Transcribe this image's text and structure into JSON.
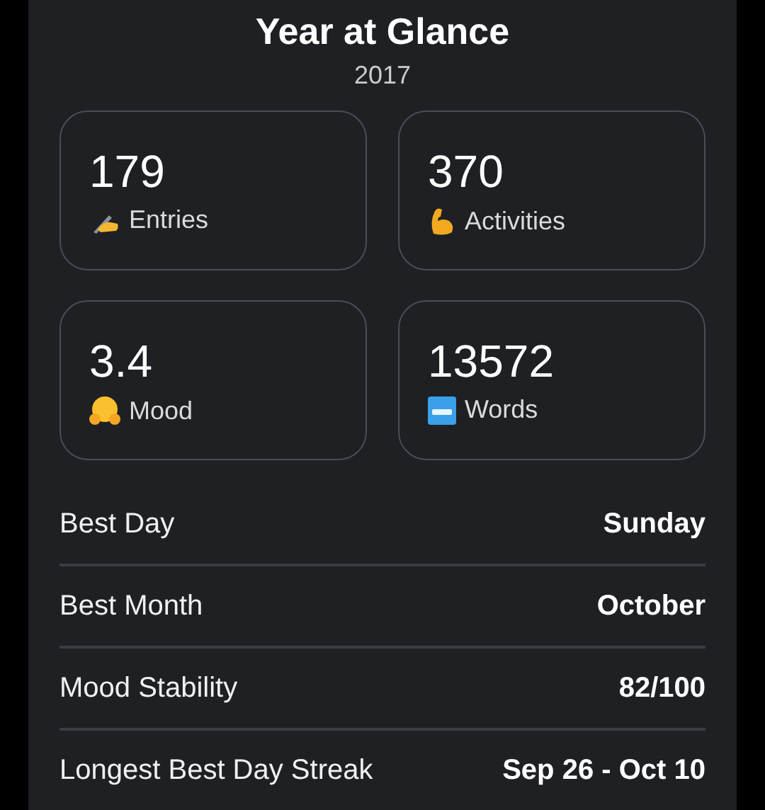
{
  "header": {
    "title": "Year at Glance",
    "year": "2017"
  },
  "stats": [
    {
      "value": "179",
      "label": "Entries",
      "kind": "writing"
    },
    {
      "value": "370",
      "label": "Activities",
      "kind": "arm"
    },
    {
      "value": "3.4",
      "label": "Mood",
      "kind": "hug"
    },
    {
      "value": "13572",
      "label": "Words",
      "kind": "abc"
    }
  ],
  "details": [
    {
      "label": "Best Day",
      "value": "Sunday"
    },
    {
      "label": "Best Month",
      "value": "October"
    },
    {
      "label": "Mood Stability",
      "value": "82/100"
    },
    {
      "label": "Longest Best Day Streak",
      "value": "Sep 26 - Oct 10"
    }
  ]
}
